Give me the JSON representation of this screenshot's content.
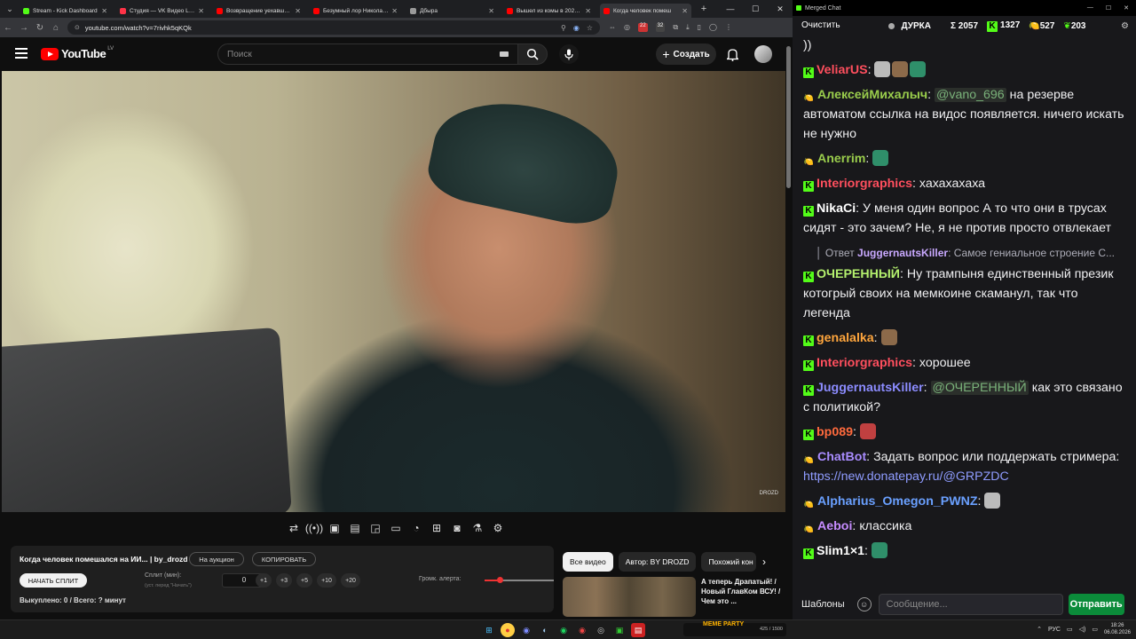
{
  "browser": {
    "tabs": [
      {
        "title": "Stream - Kick Dashboard",
        "color": "#53fc18",
        "active": false
      },
      {
        "title": "Студия — VK Видео Live",
        "color": "#ff3347",
        "active": false
      },
      {
        "title": "Возвращение уехавших ст",
        "color": "#ff0000",
        "active": false
      },
      {
        "title": "Безумный лор Николая Д",
        "color": "#ff0000",
        "active": false
      },
      {
        "title": "Дбырa",
        "color": "#9a9a9a",
        "active": false
      },
      {
        "title": "Вышел из комы в 2026 го",
        "color": "#ff0000",
        "active": false
      },
      {
        "title": "Когда человек помеш",
        "color": "#ff0000",
        "active": true
      }
    ],
    "url": "youtube.com/watch?v=7rivhk5qKQk",
    "ext_badges": [
      "22",
      "32"
    ]
  },
  "youtube": {
    "logo": "YouTube",
    "country": "LV",
    "search_placeholder": "Поиск",
    "create_label": "Создать",
    "watermark": "DROZD",
    "chips": [
      "Все видео",
      "Автор: BY DROZD",
      "Похожий кон"
    ],
    "rec_title": "А теперь Драпатый! / Новый ГлавКом ВСУ! / Чем это ..."
  },
  "split": {
    "title": "Когда человек помешался на ИИ... | by_drozd",
    "auction_btn": "На аукцион",
    "copy_btn": "КОПИРОВАТЬ",
    "start_btn": "НАЧАТЬ СПЛИТ",
    "split_label": "Сплит (мин):",
    "split_hint": "(уст. перед \"Начать\")",
    "split_value": "0",
    "increments": [
      "+1",
      "+3",
      "+5",
      "+10",
      "+20"
    ],
    "volume_label": "Громк. алерта:",
    "volume_level": 0.22,
    "stats": "Выкуплено: 0 / Всего: ? минут"
  },
  "taskbar": {
    "stream_badge": "MEME PARTY",
    "stream_count": "425 / 1500",
    "lang": "РУС",
    "time": "18:26",
    "date": "06.08.2026"
  },
  "chat": {
    "window_title": "Merged Chat",
    "clear_label": "Очистить",
    "streamer": "ДУРКА",
    "total": "Σ 2057",
    "kick_count": "1327",
    "vk_count": "527",
    "other_count": "203",
    "templates_label": "Шаблоны",
    "input_placeholder": "Сообщение...",
    "send_label": "Отправить",
    "colors": {
      "kick_green": "#53fc18",
      "send_button": "#0b8b3a"
    },
    "messages": [
      {
        "type": "text",
        "text": "))"
      },
      {
        "platform": "kick",
        "user": "VeliarUS",
        "color": "#ff4f5e",
        "emotes": 3
      },
      {
        "platform": "vk",
        "user": "АлексейМихалыч",
        "color": "#9acd4c",
        "mention": "@vano_696",
        "text": "на резерве автоматом ссылка  на видос появляется. ничего искать не нужно"
      },
      {
        "platform": "vk",
        "user": "Anerrim",
        "color": "#9acd4c",
        "emotes": 1
      },
      {
        "platform": "kick",
        "user": "Interiorgraphics",
        "color": "#ff4f5e",
        "text": "хахахахаха"
      },
      {
        "platform": "kick",
        "user": "NikaCi",
        "color": "#ffffff",
        "text": "У меня один вопрос А то что они в трусах сидят - это зачем? Не, я не против просто отвлекает"
      },
      {
        "type": "reply",
        "prefix": "Ответ",
        "user": "JuggernautsKiller",
        "text": "Самое гениальное строение С..."
      },
      {
        "platform": "kick",
        "user": "ОЧЕРЕННЫЙ",
        "color": "#b4f06e",
        "text": "Ну трампыня единственный презик котогрый своих на мемкоине скаманул, так что легенда"
      },
      {
        "platform": "kick",
        "user": "genalalka",
        "color": "#ffa63d",
        "emotes": 1
      },
      {
        "platform": "kick",
        "user": "Interiorgraphics",
        "color": "#ff4f5e",
        "text": "хорошее"
      },
      {
        "platform": "kick",
        "user": "JuggernautsKiller",
        "color": "#8c8cff",
        "mention": "@ОЧЕРЕННЫЙ",
        "text": "как это связано с политикой?"
      },
      {
        "platform": "kick",
        "user": "bp089",
        "color": "#ff6a3d",
        "emotes": 1
      },
      {
        "platform": "vk",
        "user": "ChatBot",
        "color": "#a98cff",
        "text": "Задать вопрос или поддержать стримера:",
        "link": "https://new.donatepay.ru/@GRPZDC"
      },
      {
        "platform": "vk",
        "user": "Alpharius_Omegon_PWNZ",
        "color": "#6aa0ff",
        "emotes": 1
      },
      {
        "platform": "vk",
        "user": "Aeboi",
        "color": "#c68cff",
        "text": "классика"
      },
      {
        "platform": "kick",
        "user": "Slim1×1",
        "color": "#ffffff",
        "emotes": 1
      }
    ]
  }
}
